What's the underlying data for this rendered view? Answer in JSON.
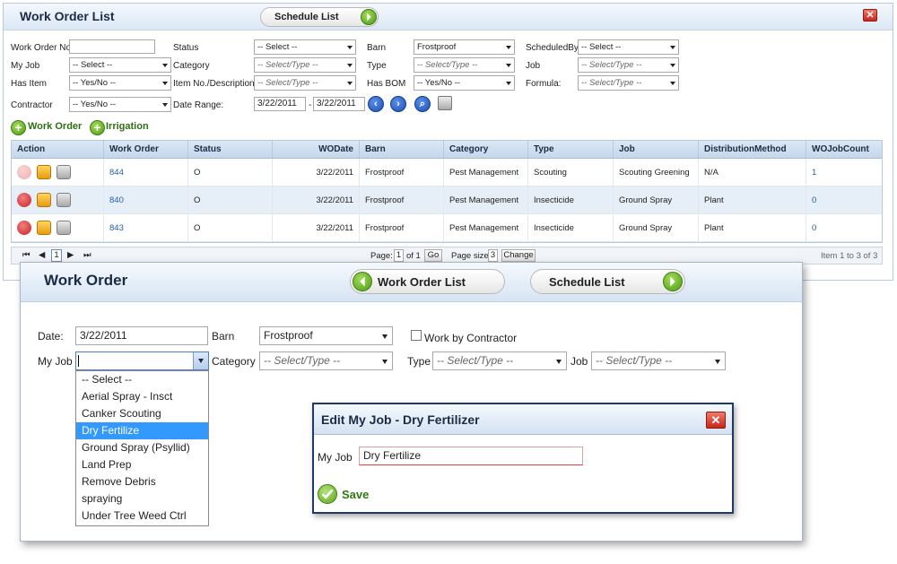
{
  "list": {
    "title": "Work Order List",
    "schedule_btn": "Schedule List",
    "close_symbol": "✕",
    "filters": {
      "wo_no_label": "Work Order No",
      "status_label": "Status",
      "status_value": "-- Select --",
      "barn_label": "Barn",
      "barn_value": "Frostproof",
      "scheduledby_label": "ScheduledBy",
      "scheduledby_value": "-- Select --",
      "myjob_label": "My Job",
      "myjob_value": "-- Select --",
      "category_label": "Category",
      "category_value": "-- Select/Type --",
      "type_label": "Type",
      "type_value": "-- Select/Type --",
      "job_label": "Job",
      "job_value": "-- Select/Type --",
      "hasitem_label": "Has Item",
      "hasitem_value": "-- Yes/No --",
      "itemno_label": "Item No./Description:",
      "itemno_value": "-- Select/Type --",
      "hasbom_label": "Has BOM",
      "hasbom_value": "-- Yes/No --",
      "formula_label": "Formula:",
      "formula_value": "-- Select/Type --",
      "contractor_label": "Contractor",
      "contractor_value": "-- Yes/No --",
      "daterange_label": "Date Range:",
      "date_from": "3/22/2011",
      "date_sep": "-",
      "date_to": "3/22/2011"
    },
    "add_workorder": "Work Order",
    "add_irrigation": "Irrigation",
    "columns": [
      "Action",
      "Work Order",
      "Status",
      "WODate",
      "Barn",
      "Category",
      "Type",
      "Job",
      "DistributionMethod",
      "WOJobCount"
    ],
    "rows": [
      {
        "wo": "844",
        "status": "O",
        "date": "3/22/2011",
        "barn": "Frostproof",
        "category": "Pest Management",
        "type": "Scouting",
        "job": "Scouting Greening",
        "dist": "N/A",
        "count": "1"
      },
      {
        "wo": "840",
        "status": "O",
        "date": "3/22/2011",
        "barn": "Frostproof",
        "category": "Pest Management",
        "type": "Insecticide",
        "job": "Ground Spray",
        "dist": "Plant",
        "count": "0"
      },
      {
        "wo": "843",
        "status": "O",
        "date": "3/22/2011",
        "barn": "Frostproof",
        "category": "Pest Management",
        "type": "Insecticide",
        "job": "Ground Spray",
        "dist": "Plant",
        "count": "0"
      }
    ],
    "pager": {
      "current_page": "1",
      "page_label": "Page:",
      "page_value": "1",
      "of_label": "of 1",
      "go": "Go",
      "size_label": "Page size:",
      "size_value": "3",
      "change": "Change",
      "summary": "Item 1 to 3 of 3"
    }
  },
  "workorder": {
    "title": "Work Order",
    "list_btn": "Work Order List",
    "schedule_btn": "Schedule List",
    "date_label": "Date:",
    "date_value": "3/22/2011",
    "barn_label": "Barn",
    "barn_value": "Frostproof",
    "contractor_label": "Work by Contractor",
    "myjob_label": "My Job",
    "myjob_value": "",
    "category_label": "Category",
    "category_value": "-- Select/Type --",
    "type_label": "Type",
    "type_value": "-- Select/Type --",
    "job_label": "Job",
    "job_value": "-- Select/Type --",
    "dropdown_options": [
      "-- Select --",
      "Aerial Spray - Insct",
      "Canker Scouting",
      "Dry Fertilize",
      "Ground Spray (Psyllid)",
      "Land Prep",
      "Remove Debris",
      "spraying",
      "Under Tree Weed Ctrl"
    ],
    "highlighted_option": "Dry Fertilize"
  },
  "dialog": {
    "title": "Edit My Job - Dry Fertilizer",
    "close_symbol": "✕",
    "myjob_label": "My Job",
    "myjob_value": "Dry Fertilize",
    "save": "Save"
  }
}
